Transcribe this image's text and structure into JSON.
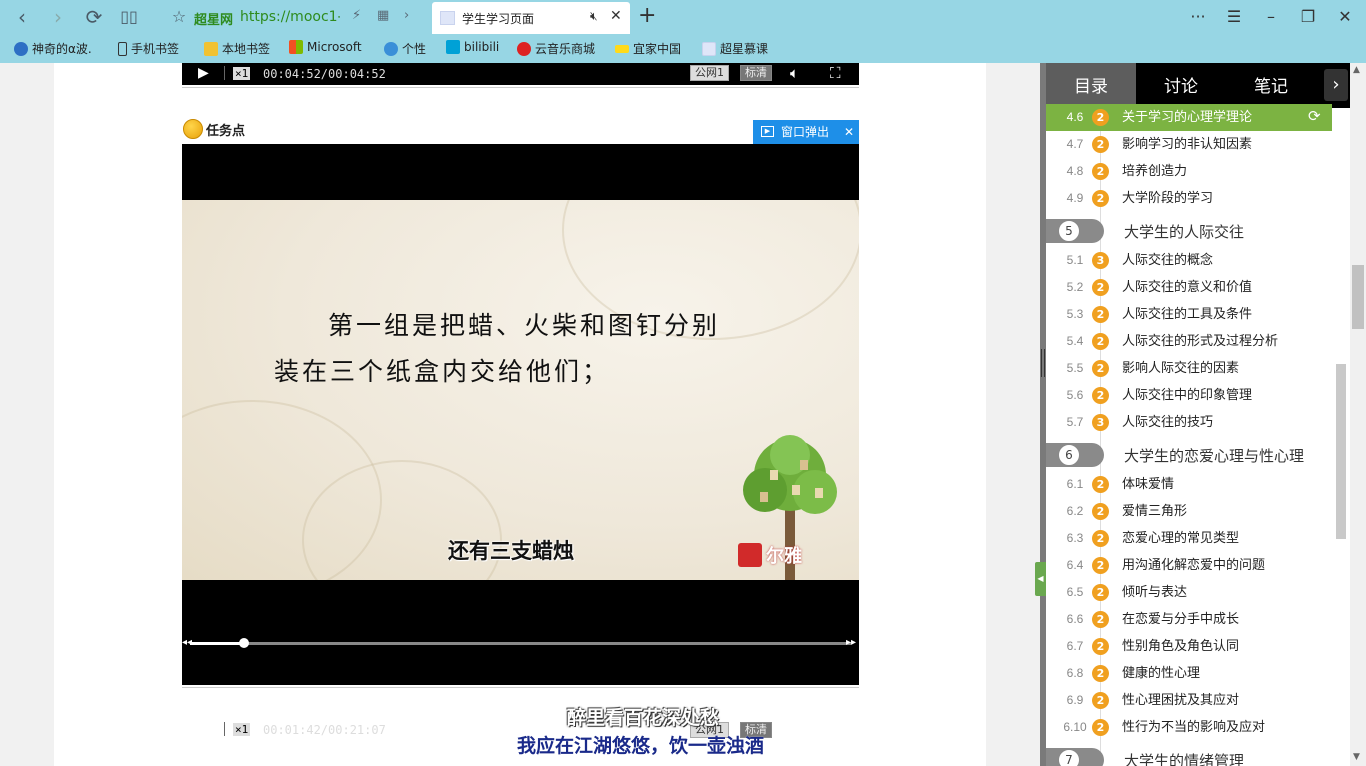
{
  "browser": {
    "address_site": "超星网",
    "address_url": "https://mooc1-",
    "active_tab_title": "学生学习页面",
    "bookmarks": [
      "神奇的α波.",
      "手机书签",
      "本地书签",
      "Microsoft",
      "个性",
      "bilibili",
      "云音乐商城",
      "宜家中国",
      "超星慕课"
    ]
  },
  "video1": {
    "speed": "×1",
    "time": "00:04:52/00:04:52",
    "net": "公网1",
    "quality": "标清"
  },
  "task": {
    "label": "任务点",
    "popout": "窗口弹出"
  },
  "video2": {
    "slide_line1": "第一组是把蜡、火柴和图钉分别",
    "slide_line2": "装在三个纸盒内交给他们；",
    "subtitle": "还有三支蜡烛",
    "watermark": "尔雅",
    "speed": "×1",
    "time": "00:01:42/00:21:07",
    "progress_fraction": 0.081,
    "net": "公网1",
    "quality": "标清"
  },
  "lyrics": {
    "line1": "醉里看百花深处愁",
    "line2": "我应在江湖悠悠，饮一壶浊酒"
  },
  "sidebar": {
    "tabs": [
      "目录",
      "讨论",
      "笔记"
    ],
    "current": {
      "num": "4.6",
      "badge": "2",
      "title": "关于学习的心理学理论"
    },
    "sections_a": [
      {
        "num": "4.7",
        "badge": "2",
        "title": "影响学习的非认知因素"
      },
      {
        "num": "4.8",
        "badge": "2",
        "title": "培养创造力"
      },
      {
        "num": "4.9",
        "badge": "2",
        "title": "大学阶段的学习"
      }
    ],
    "chapter5": {
      "num": "5",
      "title": "大学生的人际交往"
    },
    "sections_b": [
      {
        "num": "5.1",
        "badge": "3",
        "title": "人际交往的概念"
      },
      {
        "num": "5.2",
        "badge": "2",
        "title": "人际交往的意义和价值"
      },
      {
        "num": "5.3",
        "badge": "2",
        "title": "人际交往的工具及条件"
      },
      {
        "num": "5.4",
        "badge": "2",
        "title": "人际交往的形式及过程分析"
      },
      {
        "num": "5.5",
        "badge": "2",
        "title": "影响人际交往的因素"
      },
      {
        "num": "5.6",
        "badge": "2",
        "title": "人际交往中的印象管理"
      },
      {
        "num": "5.7",
        "badge": "3",
        "title": "人际交往的技巧"
      }
    ],
    "chapter6": {
      "num": "6",
      "title": "大学生的恋爱心理与性心理"
    },
    "sections_c": [
      {
        "num": "6.1",
        "badge": "2",
        "title": "体味爱情"
      },
      {
        "num": "6.2",
        "badge": "2",
        "title": "爱情三角形"
      },
      {
        "num": "6.3",
        "badge": "2",
        "title": "恋爱心理的常见类型"
      },
      {
        "num": "6.4",
        "badge": "2",
        "title": "用沟通化解恋爱中的问题"
      },
      {
        "num": "6.5",
        "badge": "2",
        "title": "倾听与表达"
      },
      {
        "num": "6.6",
        "badge": "2",
        "title": "在恋爱与分手中成长"
      },
      {
        "num": "6.7",
        "badge": "2",
        "title": "性别角色及角色认同"
      },
      {
        "num": "6.8",
        "badge": "2",
        "title": "健康的性心理"
      },
      {
        "num": "6.9",
        "badge": "2",
        "title": "性心理困扰及其应对"
      },
      {
        "num": "6.10",
        "badge": "2",
        "title": "性行为不当的影响及应对"
      }
    ],
    "chapter7": {
      "num": "7",
      "title": "大学生的情绪管理"
    }
  },
  "colors": {
    "browser_chrome": "#97d6e4",
    "current_section": "#7cb342",
    "badge": "#f0a020",
    "popout": "#1e8fe8"
  }
}
